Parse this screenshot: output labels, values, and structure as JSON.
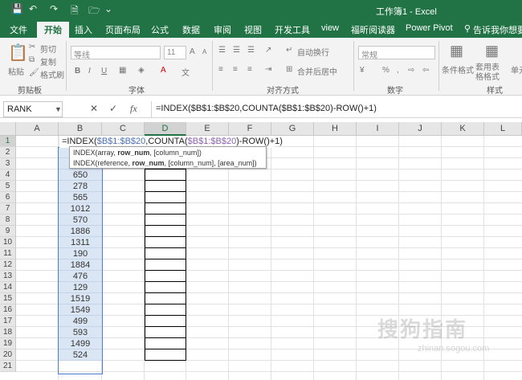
{
  "titlebar": {
    "title": "工作簿1  -  Excel",
    "save_icon": "save-icon",
    "undo_icon": "undo-icon",
    "redo_icon": "redo-icon",
    "preview_icon": "print-preview-icon",
    "customize_icon": "customize-quick-access-icon"
  },
  "tabs": [
    "文件",
    "开始",
    "插入",
    "页面布局",
    "公式",
    "数据",
    "审阅",
    "视图",
    "开发工具",
    "view",
    "福昕阅读器",
    "Power Pivot",
    "告诉我你想要做"
  ],
  "active_tab": "开始",
  "ribbon": {
    "clipboard": {
      "label": "剪贴板",
      "paste": "粘贴",
      "cut": "剪切",
      "copy": "复制",
      "format_painter": "格式刷"
    },
    "font": {
      "label": "字体",
      "font_name": "等线",
      "font_size": "11",
      "bold": "B",
      "italic": "I",
      "underline": "U",
      "grow": "A",
      "shrink": "A"
    },
    "alignment": {
      "label": "对齐方式",
      "wrap": "自动换行",
      "merge": "合并后居中"
    },
    "number": {
      "label": "数字",
      "format": "常规",
      "percent": "%"
    },
    "styles": {
      "label": "样式",
      "conditional": "条件格式",
      "table": "套用表格格式",
      "cell": "单元"
    }
  },
  "formula_bar": {
    "name_box": "RANK",
    "cancel": "✕",
    "enter": "✓",
    "fx": "fx",
    "formula": "=INDEX($B$1:$B$20,COUNTA($B$1:$B$20)-ROW()+1)"
  },
  "columns": [
    "A",
    "B",
    "C",
    "D",
    "E",
    "F",
    "G",
    "H",
    "I",
    "J",
    "K",
    "L"
  ],
  "selected_column": "D",
  "rows": [
    "1",
    "2",
    "3",
    "4",
    "5",
    "6",
    "7",
    "8",
    "9",
    "10",
    "11",
    "12",
    "13",
    "14",
    "15",
    "16",
    "17",
    "18",
    "19",
    "20",
    "21"
  ],
  "column_b_values": [
    "",
    "",
    "",
    "650",
    "278",
    "565",
    "1012",
    "570",
    "1886",
    "1311",
    "190",
    "1884",
    "476",
    "129",
    "1519",
    "1549",
    "499",
    "593",
    "1499",
    "524"
  ],
  "edit_line": {
    "p1": "=INDEX(",
    "p2": "$B$1:$B$20",
    "p3": ",COUNTA(",
    "p4": "$B$1:$B$20",
    "p5": ")-ROW()+1)"
  },
  "tooltip": {
    "line1_prefix": "INDEX(array, ",
    "line1_bold": "row_num",
    "line1_suffix": ", [column_num])",
    "line2_prefix": "INDEX(reference, ",
    "line2_bold": "row_num",
    "line2_suffix": ", [column_num], [area_num])"
  },
  "watermark": {
    "text": "搜狗指南",
    "sub": "zhinan.sogou.com"
  }
}
